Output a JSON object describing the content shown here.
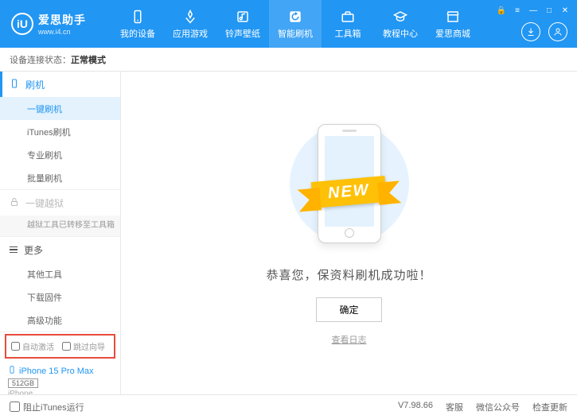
{
  "brand": {
    "title": "爱思助手",
    "url": "www.i4.cn",
    "logo_letter": "iU"
  },
  "nav": [
    {
      "label": "我的设备"
    },
    {
      "label": "应用游戏"
    },
    {
      "label": "铃声壁纸"
    },
    {
      "label": "智能刷机",
      "active": true
    },
    {
      "label": "工具箱"
    },
    {
      "label": "教程中心"
    },
    {
      "label": "爱思商城"
    }
  ],
  "status": {
    "prefix": "设备连接状态：",
    "value": "正常模式"
  },
  "sidebar": {
    "flash": {
      "head": "刷机",
      "items": [
        "一键刷机",
        "iTunes刷机",
        "专业刷机",
        "批量刷机"
      ],
      "active_index": 0
    },
    "jailbreak": {
      "head": "一键越狱",
      "note": "越狱工具已转移至工具箱"
    },
    "more": {
      "head": "更多",
      "items": [
        "其他工具",
        "下载固件",
        "高级功能"
      ]
    },
    "options": {
      "auto_activate": "自动激活",
      "skip_guide": "跳过向导"
    },
    "device": {
      "name": "iPhone 15 Pro Max",
      "storage": "512GB",
      "type": "iPhone"
    }
  },
  "main": {
    "ribbon": "NEW",
    "success": "恭喜您，保资料刷机成功啦！",
    "ok": "确定",
    "log": "查看日志"
  },
  "footer": {
    "block_itunes": "阻止iTunes运行",
    "version": "V7.98.66",
    "links": [
      "客服",
      "微信公众号",
      "检查更新"
    ]
  }
}
